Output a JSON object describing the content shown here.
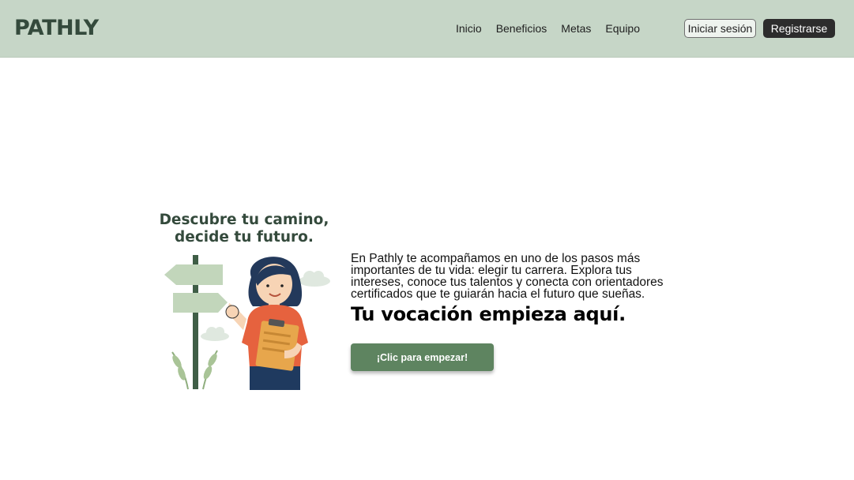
{
  "header": {
    "logo": "PATHLY",
    "nav": [
      "Inicio",
      "Beneficios",
      "Metas",
      "Equipo"
    ],
    "login_label": "Iniciar sesión",
    "register_label": "Registrarse",
    "background": "#c6d6c7"
  },
  "hero": {
    "title_lines": [
      "Descubre tu camino,",
      "decide tu futuro."
    ],
    "description_lines": [
      "En Pathly te acompañamos en uno de los pasos más",
      "importantes de tu vida: elegir tu carrera. Explora tus",
      "intereses, conoce tus talentos y conecta con orientadores",
      "certificados que te guiarán hacia el futuro que sueñas."
    ],
    "tagline": "Tu vocación empieza aquí.",
    "cta_label": "¡Clic para empezar!",
    "accent": "#5e8460",
    "illustration": "girl-with-clipboard-and-signpost"
  }
}
